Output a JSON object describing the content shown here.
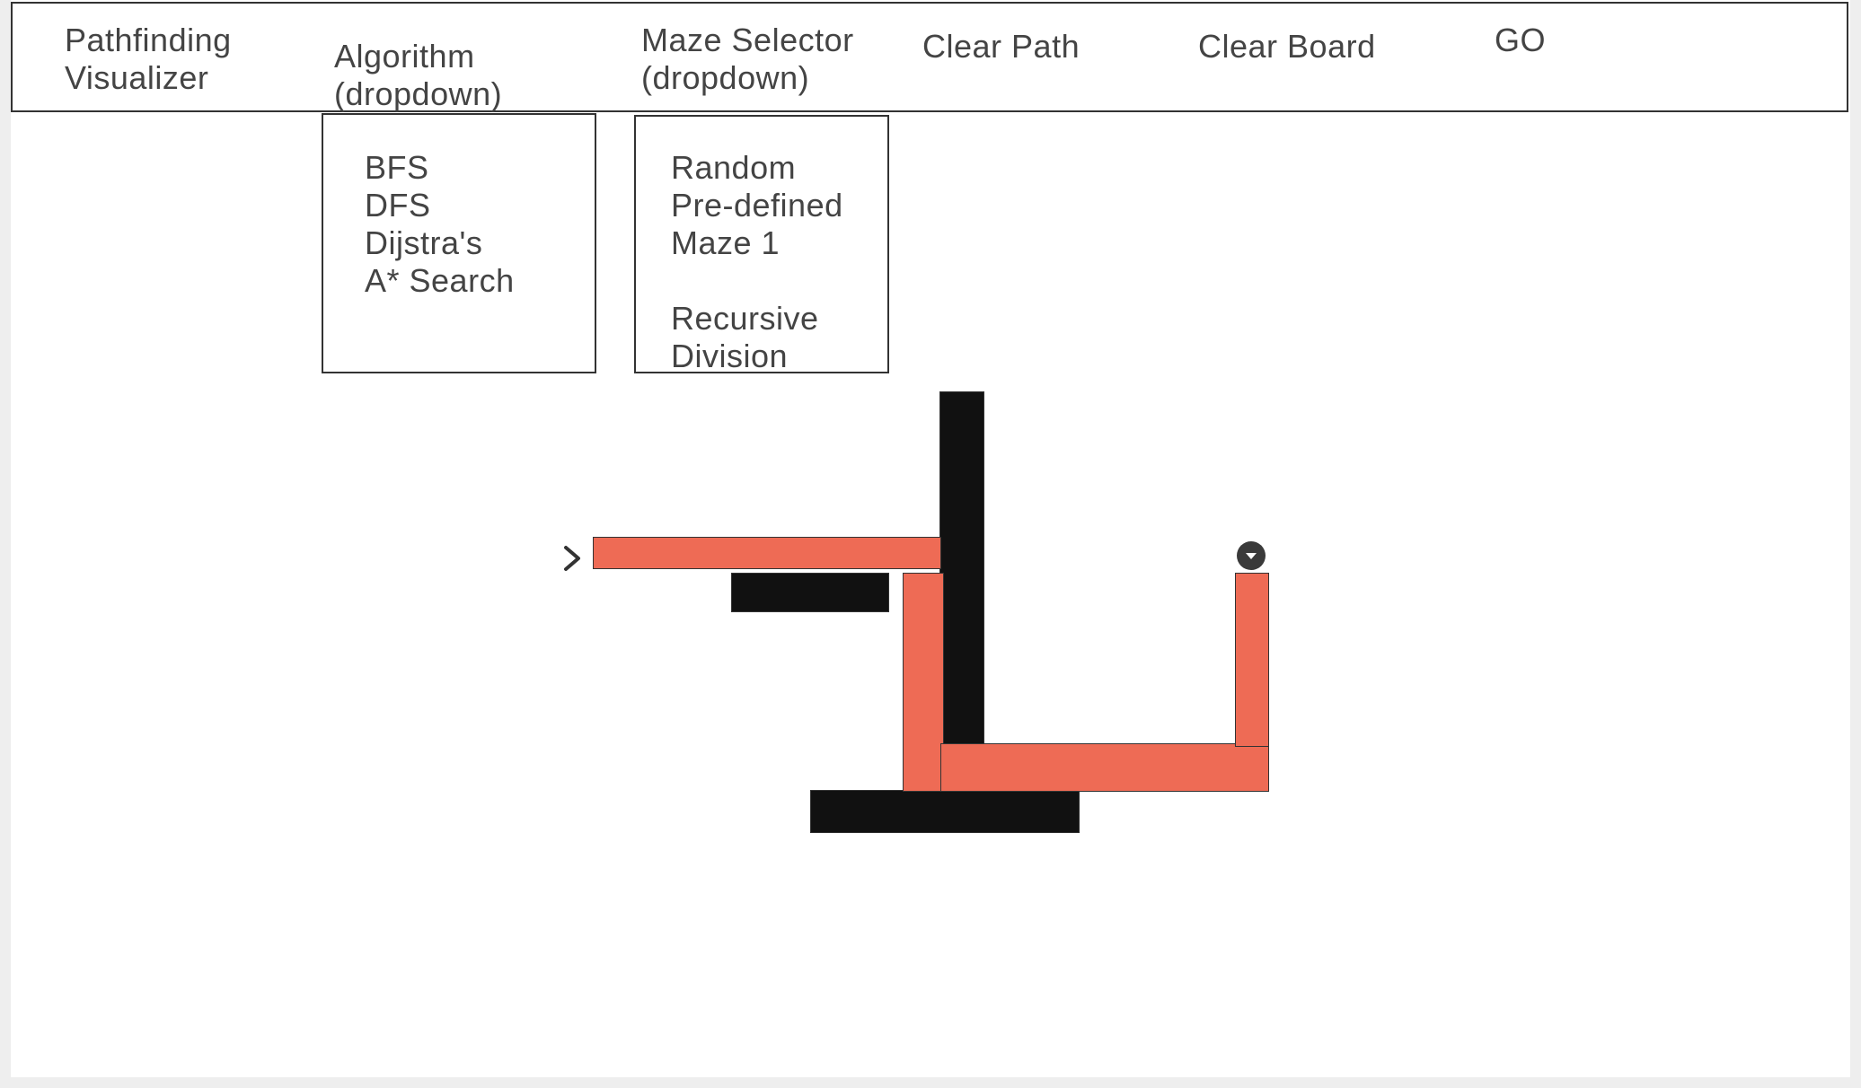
{
  "navbar": {
    "title": "Pathfinding\nVisualizer",
    "algorithm_label": "Algorithm\n(dropdown)",
    "maze_label": "Maze Selector\n(dropdown)",
    "clear_path": "Clear Path",
    "clear_board": "Clear Board",
    "go": "GO"
  },
  "algorithm_dropdown": {
    "options": [
      "BFS",
      "DFS",
      "Dijstra's",
      "A* Search"
    ]
  },
  "maze_dropdown": {
    "options": [
      "Random",
      "Pre-defined\nMaze 1",
      "Recursive\nDivision"
    ]
  },
  "grid": {
    "start_icon": "chevron-right-icon",
    "target_icon": "circle-caret-down-icon",
    "colors": {
      "wall": "#111111",
      "path": "#ee6b55",
      "grid_line": "#eeeeee",
      "grid_major": "#d9d9d9"
    }
  }
}
